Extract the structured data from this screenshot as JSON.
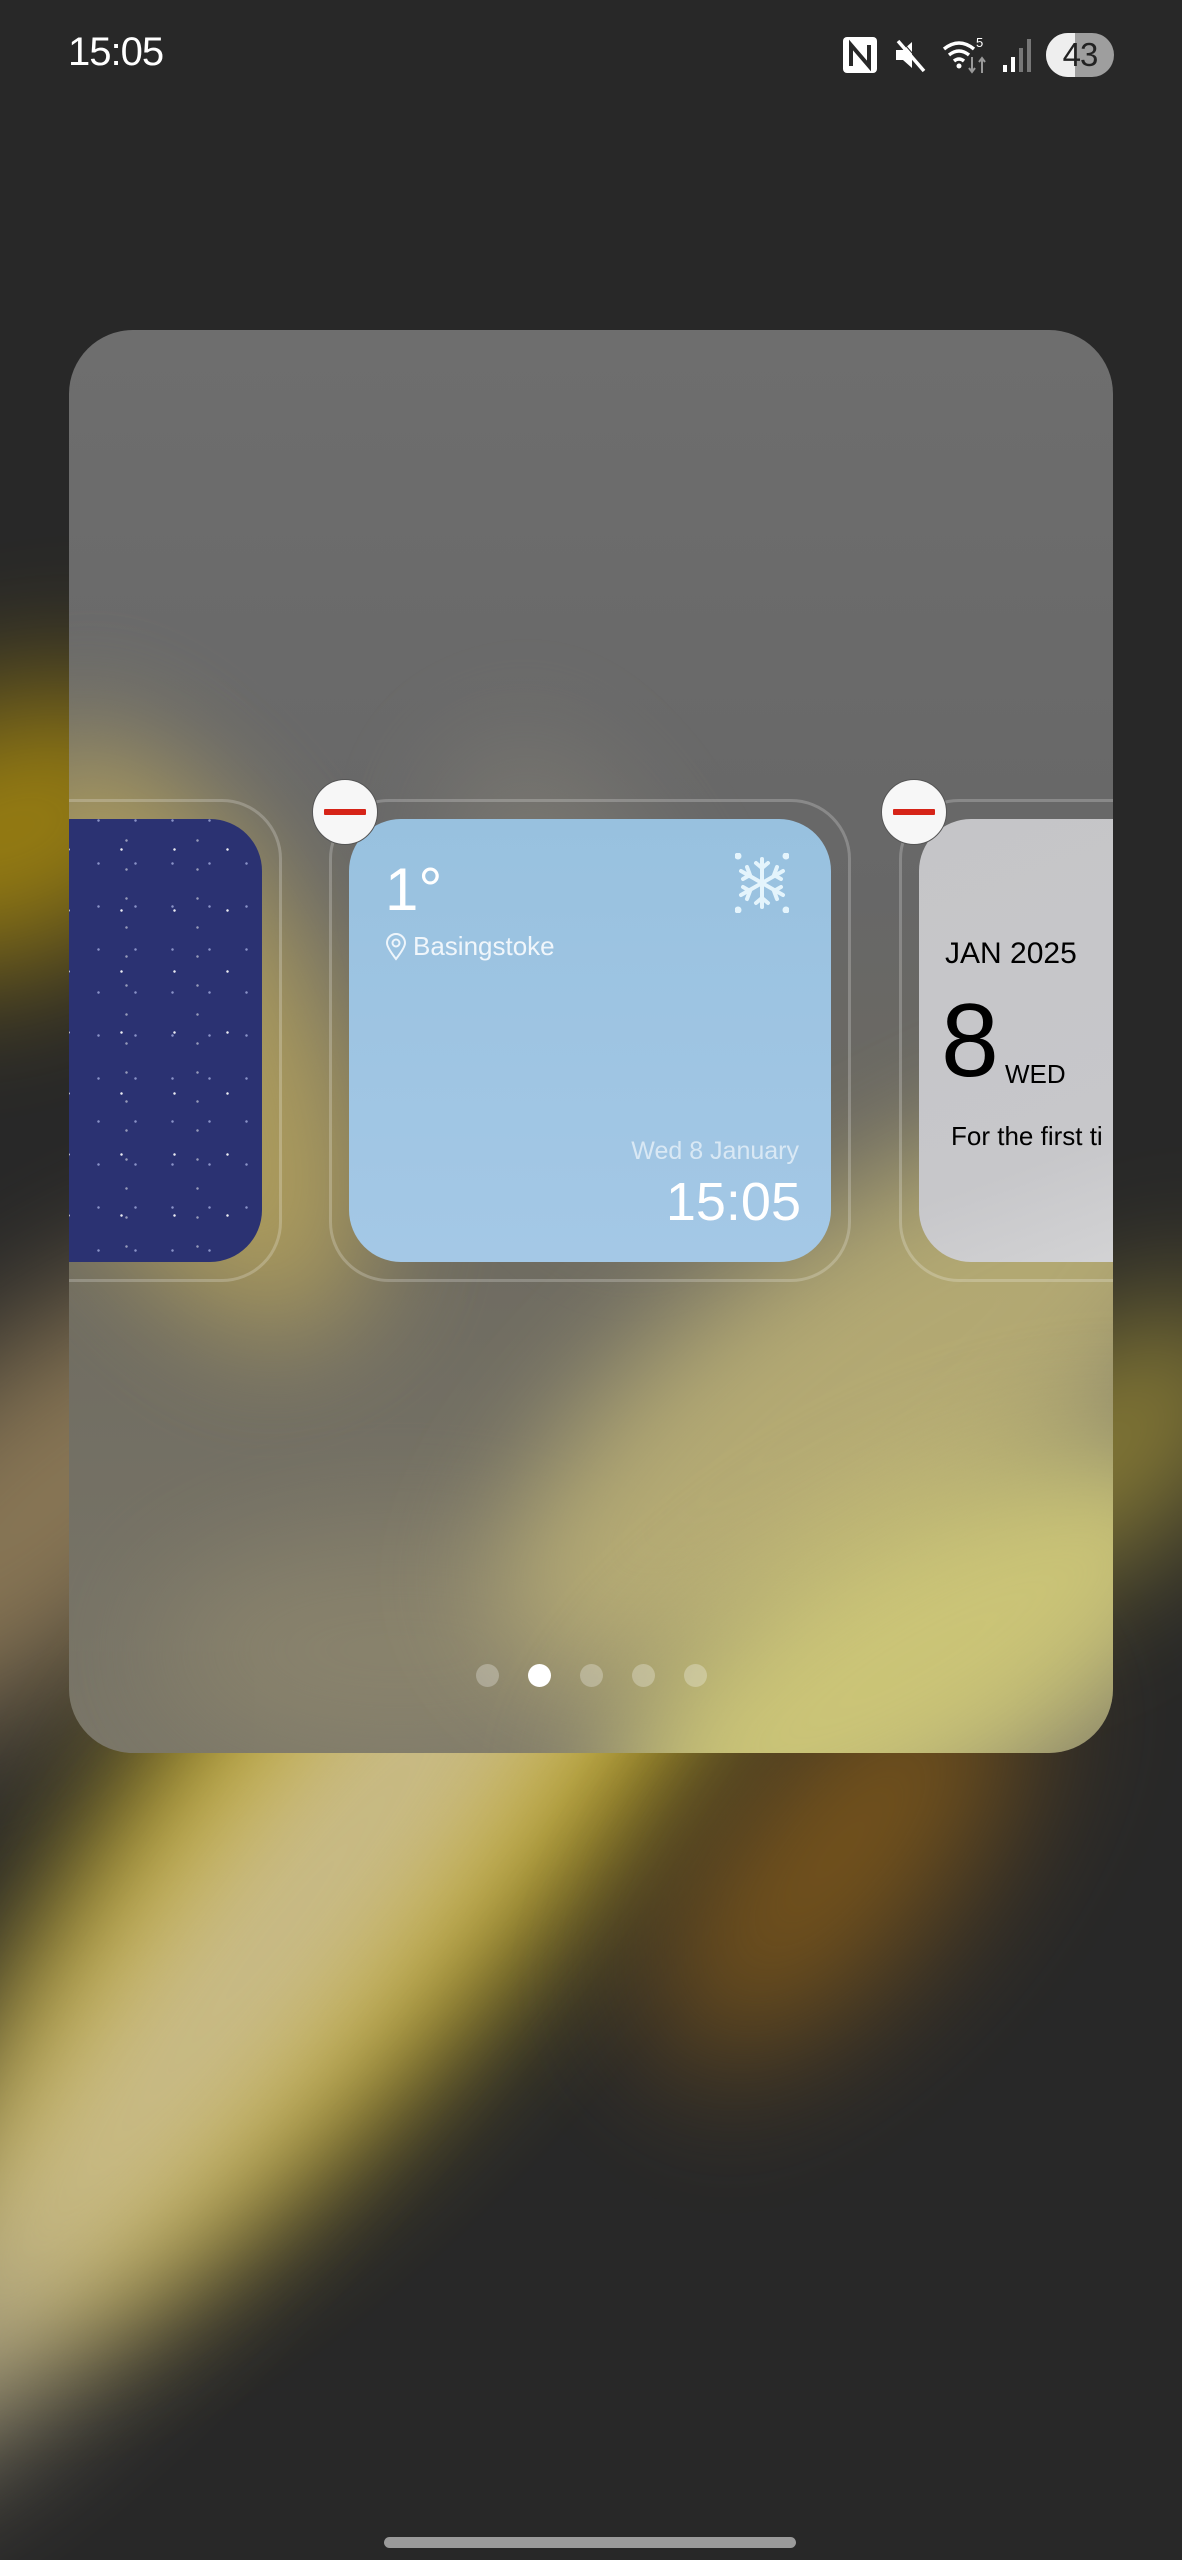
{
  "status_bar": {
    "time": "15:05",
    "icons": [
      "nfc-icon",
      "mute-icon",
      "wifi-icon",
      "signal-icon"
    ],
    "wifi_badge": "5",
    "battery_level": "43",
    "battery_fraction": 0.43
  },
  "widget_picker": {
    "widgets": [
      {
        "name": "starry-sky-widget",
        "partially_visible": true
      },
      {
        "name": "weather-widget",
        "temperature": "1°",
        "location": "Basingstoke",
        "condition_icon": "snowflake-icon",
        "date": "Wed 8 January",
        "time": "15:05",
        "background_color": "#a0c4e2"
      },
      {
        "name": "calendar-widget",
        "partially_visible": true,
        "month_year": "JAN 2025",
        "day_number": "8",
        "weekday": "WED",
        "note": "For the first ti"
      }
    ],
    "remove_button_color": "#d62418",
    "page_count": 5,
    "current_page": 2
  }
}
